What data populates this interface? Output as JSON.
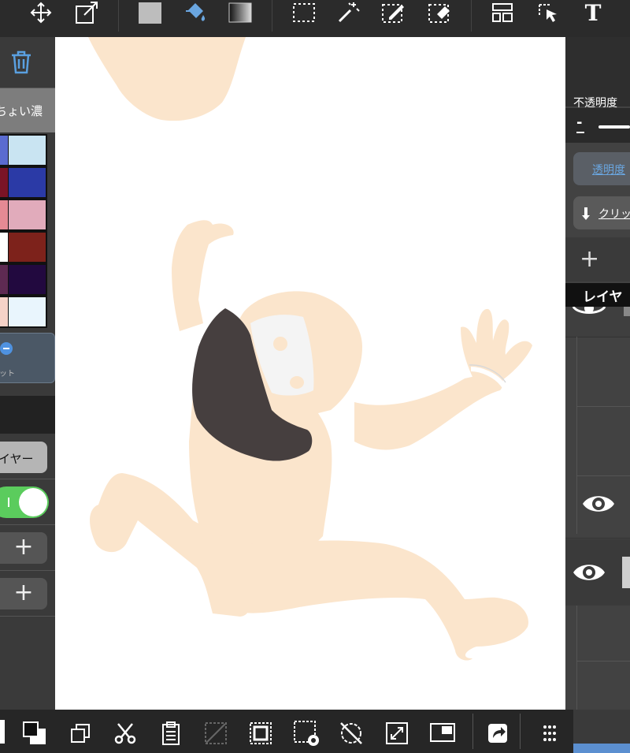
{
  "left_panel": {
    "brush_name": "ちょい濃",
    "palette_colors": [
      [
        "#5a6bd0",
        "#c9e4f2"
      ],
      [
        "#7a1426",
        "#2b3aa6"
      ],
      [
        "#e58a94",
        "#e1abbb"
      ],
      [
        "#ffffff",
        "#7d221b"
      ],
      [
        "#5e2a52",
        "#22093f"
      ],
      [
        "#f6d3c8",
        "#e9f5fd"
      ]
    ],
    "palette_button_label": "ット",
    "layer_button_label": "イヤー",
    "toggle_on": true,
    "add_label": "+"
  },
  "right_panel": {
    "opacity_label": "不透明度",
    "opacity_minus": "-",
    "transparency_button": "透明度",
    "clipping_button": "クリッ",
    "add_layer": "+",
    "layer_header": "レイヤ"
  },
  "colors": {
    "skin": "#fbe5cc",
    "hair": "#463f3f",
    "accent_blue": "#6aa6e0",
    "toggle_green": "#5bcc5d"
  },
  "icons": {
    "top": [
      "move-icon",
      "transform-icon",
      "fill-color-swatch",
      "bucket-icon",
      "gradient-icon",
      "select-rect-icon",
      "magic-wand-icon",
      "select-pen-icon",
      "select-eraser-icon",
      "layout-icon",
      "select-arrow-icon",
      "text-icon"
    ],
    "bottom": [
      "swap-colors-icon",
      "copy-icon",
      "cut-icon",
      "paste-icon",
      "clear-icon",
      "crop-icon",
      "select-layer-icon",
      "rotate-off-icon",
      "fit-icon",
      "canvas-ratio-icon",
      "share-icon",
      "grid-menu-icon"
    ]
  }
}
